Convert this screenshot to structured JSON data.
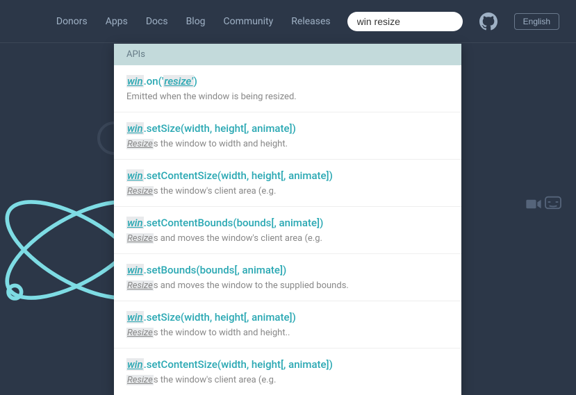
{
  "nav": {
    "links": [
      "Donors",
      "Apps",
      "Docs",
      "Blog",
      "Community",
      "Releases"
    ]
  },
  "search": {
    "value": "win resize"
  },
  "lang": "English",
  "dropdown": {
    "section": "APIs",
    "items": [
      {
        "title_pre_hl": "win",
        "title_mid": ".on('",
        "title_hl2": "resize'",
        "title_post": ")",
        "desc_pre": "",
        "desc_hl": "",
        "desc_post": "Emitted when the window is being resized."
      },
      {
        "title_pre_hl": "win",
        "title_mid": ".setSize(width, height[, animate])",
        "title_hl2": "",
        "title_post": "",
        "desc_pre": "",
        "desc_hl": "Resize",
        "desc_post": "s the window to width and height."
      },
      {
        "title_pre_hl": "win",
        "title_mid": ".setContentSize(width, height[, animate])",
        "title_hl2": "",
        "title_post": "",
        "desc_pre": "",
        "desc_hl": "Resize",
        "desc_post": "s the window's client area (e.g."
      },
      {
        "title_pre_hl": "win",
        "title_mid": ".setContentBounds(bounds[, animate])",
        "title_hl2": "",
        "title_post": "",
        "desc_pre": "",
        "desc_hl": "Resize",
        "desc_post": "s and moves the window's client area (e.g."
      },
      {
        "title_pre_hl": "win",
        "title_mid": ".setBounds(bounds[, animate])",
        "title_hl2": "",
        "title_post": "",
        "desc_pre": "",
        "desc_hl": "Resize",
        "desc_post": "s and moves the window to the supplied bounds."
      },
      {
        "title_pre_hl": "win",
        "title_mid": ".setSize(width, height[, animate])",
        "title_hl2": "",
        "title_post": "",
        "desc_pre": "",
        "desc_hl": "Resize",
        "desc_post": "s the window to width and height.."
      },
      {
        "title_pre_hl": "win",
        "title_mid": ".setContentSize(width, height[, animate])",
        "title_hl2": "",
        "title_post": "",
        "desc_pre": "",
        "desc_hl": "Resize",
        "desc_post": "s the window's client area (e.g."
      }
    ]
  }
}
